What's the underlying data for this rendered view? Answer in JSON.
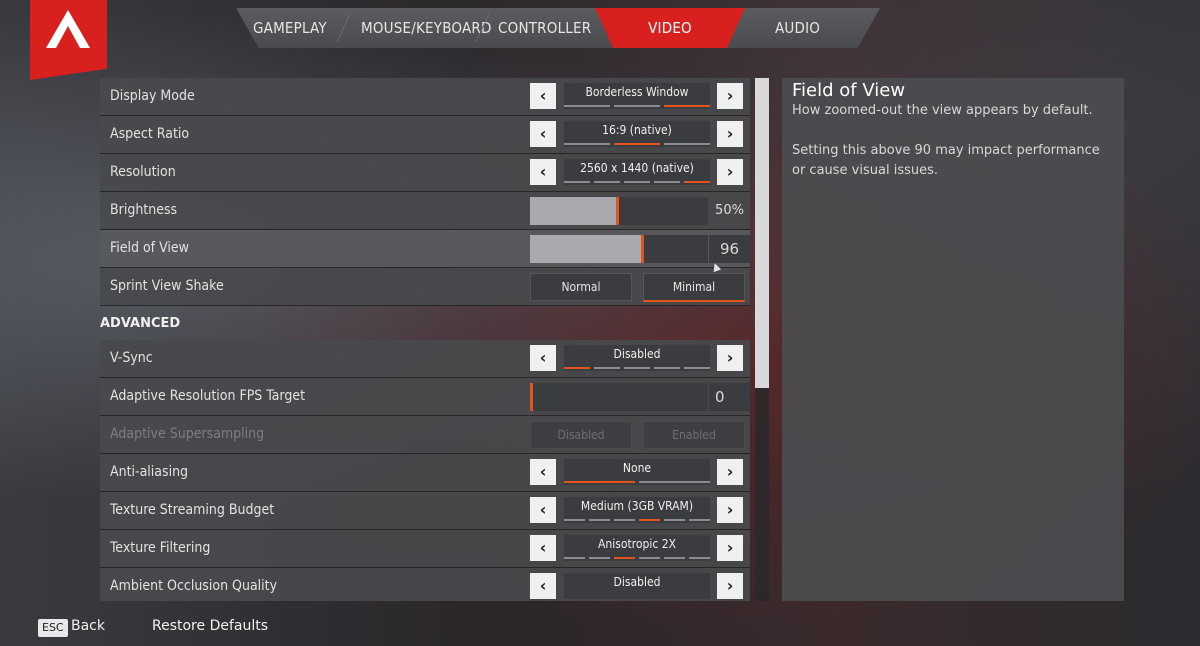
{
  "tabs": [
    {
      "label": "GAMEPLAY"
    },
    {
      "label": "MOUSE/KEYBOARD"
    },
    {
      "label": "CONTROLLER"
    },
    {
      "label": "VIDEO"
    },
    {
      "label": "AUDIO"
    }
  ],
  "active_tab": "VIDEO",
  "settings": {
    "display_mode": {
      "label": "Display Mode",
      "value": "Borderless Window",
      "steps": 3,
      "selected_step": 3
    },
    "aspect_ratio": {
      "label": "Aspect Ratio",
      "value": "16:9 (native)",
      "steps": 3,
      "selected_step": 2
    },
    "resolution": {
      "label": "Resolution",
      "value": "2560 x 1440 (native)",
      "steps": 5,
      "selected_step": 5
    },
    "brightness": {
      "label": "Brightness",
      "value": "50%",
      "level": 0.5
    },
    "field_of_view": {
      "label": "Field of View",
      "value": "96",
      "level": 0.63
    },
    "sprint_view_shake": {
      "label": "Sprint View Shake",
      "options": [
        "Normal",
        "Minimal"
      ],
      "selected": "Minimal"
    }
  },
  "advanced": {
    "title": "ADVANCED",
    "vsync": {
      "label": "V-Sync",
      "value": "Disabled",
      "steps": 5,
      "selected_step": 1
    },
    "adaptive_res": {
      "label": "Adaptive Resolution FPS Target",
      "value": "0",
      "level": 0.0
    },
    "adaptive_supersampling": {
      "label": "Adaptive Supersampling",
      "options": [
        "Disabled",
        "Enabled"
      ]
    },
    "anti_aliasing": {
      "label": "Anti-aliasing",
      "value": "None",
      "steps": 2,
      "selected_step": 1
    },
    "texture_budget": {
      "label": "Texture Streaming Budget",
      "value": "Medium (3GB VRAM)",
      "steps": 6,
      "selected_step": 4
    },
    "texture_filtering": {
      "label": "Texture Filtering",
      "value": "Anisotropic 2X",
      "steps": 6,
      "selected_step": 3
    },
    "ambient_occlusion": {
      "label": "Ambient Occlusion Quality",
      "value": "Disabled"
    }
  },
  "description": {
    "title": "Field of View",
    "line1": "How zoomed-out the view appears by default.",
    "line2": "Setting this above 90 may impact performance or cause visual issues."
  },
  "footer": {
    "esc_key": "ESC",
    "back_label": "Back",
    "restore_label": "Restore Defaults"
  },
  "colors": {
    "accent": "#e3541c",
    "brand_red": "#d8201f"
  }
}
